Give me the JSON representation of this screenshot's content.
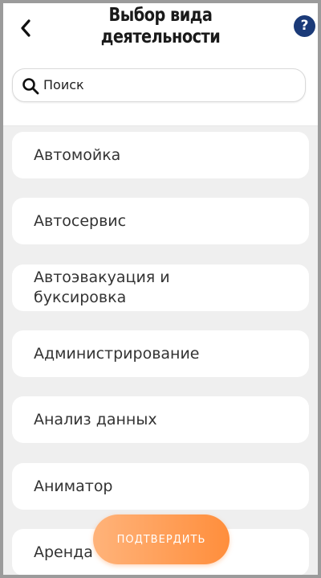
{
  "header": {
    "title": "Выбор вида деятельности",
    "back_icon": "chevron-left-icon",
    "help_label": "?"
  },
  "search": {
    "placeholder": "Поиск",
    "icon": "search-icon"
  },
  "activities": [
    {
      "label": "Автомойка"
    },
    {
      "label": "Автосервис"
    },
    {
      "label": "Автоэвакуация и буксировка"
    },
    {
      "label": "Администрирование"
    },
    {
      "label": "Анализ данных"
    },
    {
      "label": "Аниматор"
    },
    {
      "label": "Аренда"
    }
  ],
  "confirm_button": {
    "label": "ПОДТВЕРДИТЬ"
  },
  "colors": {
    "accent": "#ff8e3c",
    "help_badge": "#1b3a78",
    "background": "#efefef"
  }
}
